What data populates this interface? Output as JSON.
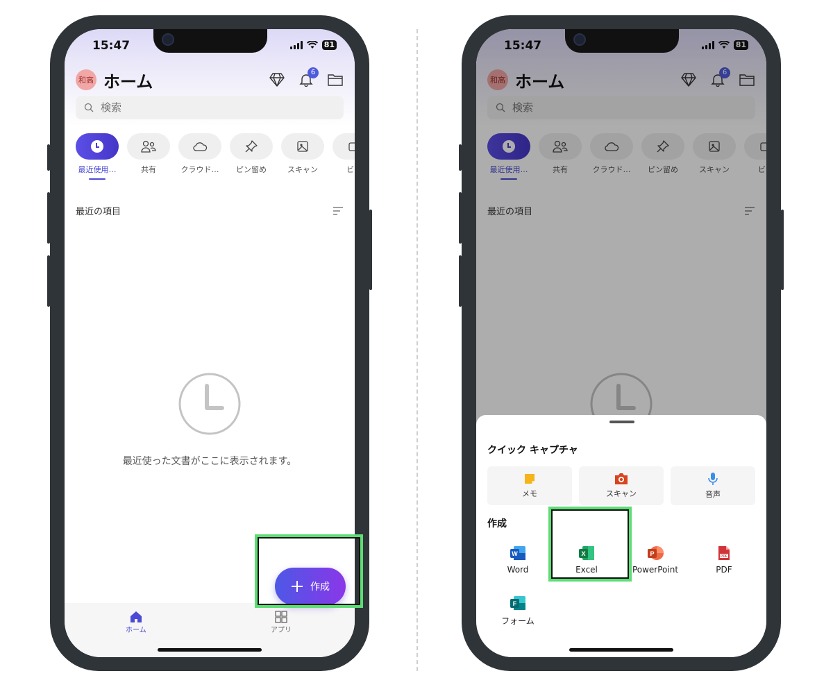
{
  "status": {
    "time": "15:47",
    "battery": "81"
  },
  "header": {
    "avatar": "和高",
    "title": "ホーム",
    "notifications": "6"
  },
  "search": {
    "placeholder": "検索"
  },
  "categories": [
    {
      "label": "最近使用…",
      "icon": "clock-icon"
    },
    {
      "label": "共有",
      "icon": "people-icon"
    },
    {
      "label": "クラウド…",
      "icon": "cloud-icon"
    },
    {
      "label": "ピン留め",
      "icon": "pin-icon"
    },
    {
      "label": "スキャン",
      "icon": "image-scan-icon"
    },
    {
      "label": "ビデ",
      "icon": "video-icon"
    }
  ],
  "section": {
    "title": "最近の項目"
  },
  "empty": {
    "message": "最近使った文書がここに表示されます。"
  },
  "fab": {
    "label": "作成"
  },
  "tabs": {
    "home": "ホーム",
    "apps": "アプリ"
  },
  "sheet": {
    "quick_title": "クイック キャプチャ",
    "quick": [
      {
        "label": "メモ",
        "icon": "note-icon"
      },
      {
        "label": "スキャン",
        "icon": "camera-icon"
      },
      {
        "label": "音声",
        "icon": "mic-icon"
      }
    ],
    "create_title": "作成",
    "create": [
      {
        "label": "Word",
        "icon": "word-icon",
        "color": "#185abd"
      },
      {
        "label": "Excel",
        "icon": "excel-icon",
        "color": "#107c41"
      },
      {
        "label": "PowerPoint",
        "icon": "powerpoint-icon",
        "color": "#c43e1c"
      },
      {
        "label": "PDF",
        "icon": "pdf-icon",
        "color": "#d13438"
      },
      {
        "label": "フォーム",
        "icon": "forms-icon",
        "color": "#038387"
      }
    ]
  },
  "colors": {
    "accent": "#4a4ad4",
    "highlight": "#5ddd75"
  }
}
